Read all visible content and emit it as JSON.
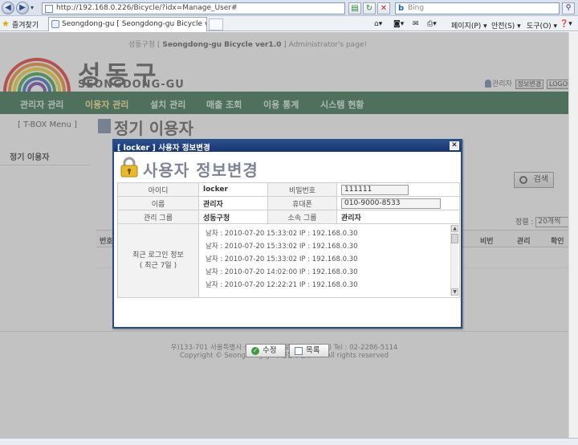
{
  "browser": {
    "url": "http://192.168.0.226/Bicycle/?idx=Manage_User#",
    "search_placeholder": "Bing",
    "favorites_label": "즐겨찾기",
    "tab_title": "Seongdong-gu [ Seongdong-gu Bicycle ver1...",
    "commands": {
      "page": "페이지(P) ▾",
      "safety": "안전(S) ▾",
      "tools": "도구(O) ▾",
      "help": "❓▾"
    }
  },
  "site": {
    "top_caption_prefix": "성동구청 [",
    "top_caption_bold": "Seongdong-gu Bicycle ver1.0",
    "top_caption_suffix": "] Administrator's page!",
    "logo_korean": "성동구",
    "logo_english": "SEONGDONG-GU",
    "admin_label": "관리자",
    "admin_info_btn": "정보변경",
    "logout_btn": "LOGOUT",
    "nav": [
      "관리자 관리",
      "이용자 관리",
      "설치 관리",
      "매출 조회",
      "이용 통계",
      "시스템 현황"
    ],
    "tbox": "[ T-BOX Menu ]",
    "side_item": "정기 이용자",
    "page_heading": "정기 이용자",
    "search_btn": "검색",
    "sort_label": "정렬 :",
    "sort_value": "20개씩",
    "bg_columns": [
      "번호",
      "비번",
      "관리",
      "확인"
    ],
    "footer_address": "우)133-701 서울특별시 성동구 고산자로 10(행당동 7) Tel : 02-2286-5114",
    "footer_copyright": "Copyright © Seongdong-gu ( 성동구청 ) Co. All rights reserved"
  },
  "dialog": {
    "title": "[ locker ] 사용자 정보변경",
    "close_icon": "close-icon",
    "heading": "사용자 정보변경",
    "fields": {
      "id_label": "아이디",
      "id_value": "locker",
      "password_label": "비밀번호",
      "password_value": "111111",
      "name_label": "이름",
      "name_value": "관리자",
      "phone_label": "휴대폰",
      "phone_value": "010-9000-8533",
      "group_label": "관리 그룹",
      "group_value": "성동구청",
      "affiliation_label": "소속 그룹",
      "affiliation_value": "관리자",
      "login_label_1": "최근 로그인 정보",
      "login_label_2": "( 최근 7일 )"
    },
    "login_history": [
      "날자 : 2010-07-20 15:33:02   IP : 192.168.0.30",
      "날자 : 2010-07-20 15:33:02   IP : 192.168.0.30",
      "날자 : 2010-07-20 15:33:02   IP : 192.168.0.30",
      "날자 : 2010-07-20 14:02:00   IP : 192.168.0.30",
      "날자 : 2010-07-20 12:22:21   IP : 192.168.0.30"
    ],
    "edit_btn": "수정",
    "list_btn": "목록"
  },
  "colors": {
    "nav_green": "#2c6a45",
    "dialog_blue": "#274d86",
    "active_nav": "#ffe58a"
  }
}
